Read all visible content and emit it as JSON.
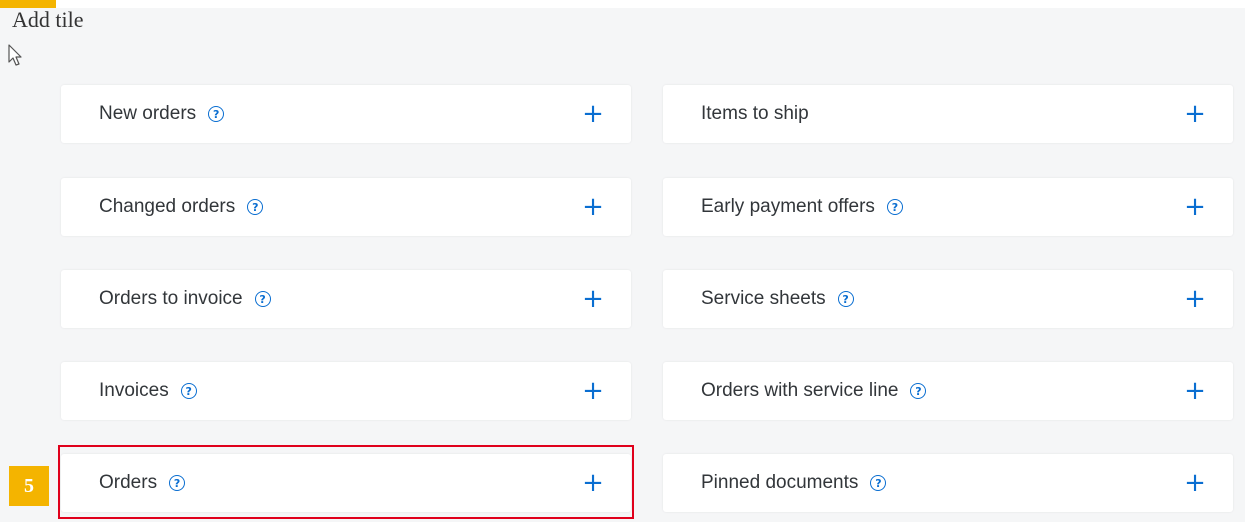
{
  "page": {
    "title": "Add tile"
  },
  "step": {
    "number": "5"
  },
  "tiles": [
    {
      "label": "New orders",
      "help": true
    },
    {
      "label": "Items to ship",
      "help": false
    },
    {
      "label": "Changed orders",
      "help": true
    },
    {
      "label": "Early payment offers",
      "help": true
    },
    {
      "label": "Orders to invoice",
      "help": true
    },
    {
      "label": "Service sheets",
      "help": true
    },
    {
      "label": "Invoices",
      "help": true
    },
    {
      "label": "Orders with service line",
      "help": true
    },
    {
      "label": "Orders",
      "help": true,
      "highlighted": true
    },
    {
      "label": "Pinned documents",
      "help": true
    }
  ],
  "icons": {
    "help": "?",
    "add": "+"
  },
  "colors": {
    "accent": "#0a6ed1",
    "highlight": "#e0001b",
    "step_badge": "#f4b400",
    "background": "#f5f6f7",
    "tile": "#ffffff"
  }
}
